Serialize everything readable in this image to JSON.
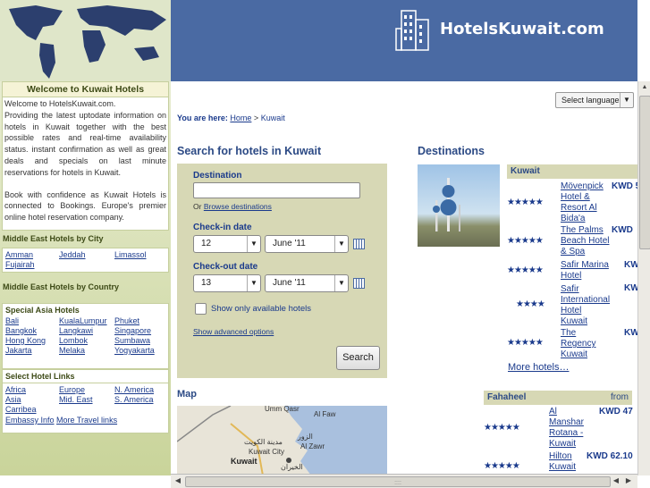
{
  "header": {
    "site_name": "HotelsKuwait.com"
  },
  "sidebar": {
    "welcome": {
      "title": "Welcome to Kuwait Hotels",
      "p1": "Welcome to HotelsKuwait.com.",
      "p2": "Providing the latest uptodate information on hotels in Kuwait together with the best possible rates and real-time availability status. instant confirmation as well as great deals and specials on last minute reservations for hotels in Kuwait.",
      "p3": "Book with confidence as Kuwait Hotels is connected to Bookings. Europe's premier online hotel reservation company."
    },
    "me_city": {
      "title": "Middle East Hotels by City",
      "links": [
        "Amman",
        "Jeddah",
        "Limassol",
        "Fujairah"
      ]
    },
    "me_country": {
      "title": "Middle East Hotels by Country"
    },
    "asia": {
      "title": "Special Asia Hotels",
      "links": [
        "Bali",
        "KualaLumpur",
        "Phuket",
        "Bangkok",
        "Langkawi",
        "Singapore",
        "Hong Kong",
        "Lombok",
        "Sumbawa",
        "Jakarta",
        "Melaka",
        "Yogyakarta"
      ]
    },
    "select": {
      "title": "Select Hotel Links",
      "links": [
        "Africa",
        "Europe",
        "N. America",
        "Asia",
        "Mid. East",
        "S. America",
        "Carribea"
      ],
      "embassy": "Embassy Info",
      "more": "More Travel links"
    }
  },
  "lang": {
    "label": "Select language",
    "arrow": "▼"
  },
  "breadcrumb": {
    "prefix": "You are here:",
    "home": "Home",
    "sep": ">",
    "current": "Kuwait"
  },
  "search": {
    "title": "Search for hotels in Kuwait",
    "destination_label": "Destination",
    "destination_value": "",
    "or": "Or",
    "browse": "Browse destinations",
    "checkin_label": "Check-in date",
    "checkin_day": "12",
    "checkin_month": "June '11",
    "checkout_label": "Check-out date",
    "checkout_day": "13",
    "checkout_month": "June '11",
    "available_only": "Show only available hotels",
    "advanced": "Show advanced options",
    "button": "Search"
  },
  "map": {
    "title": "Map",
    "labels": [
      "Umm Qasr",
      "Al Faw",
      "الزور",
      "مدينة الكويت",
      "Al Zawr",
      "Kuwait City",
      "Kuwait",
      "الخيران"
    ]
  },
  "destinations": {
    "title": "Destinations",
    "kuwait": {
      "name": "Kuwait",
      "more": "More hotels…",
      "hotels": [
        {
          "stars": "★★★★★",
          "name": "Mövenpick Hotel & Resort Al Bida'a",
          "price": "KWD 5"
        },
        {
          "stars": "★★★★★",
          "name": "The Palms Beach Hotel & Spa",
          "price": "KWD"
        },
        {
          "stars": "★★★★★",
          "name": "Safir Marina Hotel",
          "price": "KW"
        },
        {
          "stars": "★★★★",
          "name": "Safir International Hotel Kuwait",
          "price": "KW"
        },
        {
          "stars": "★★★★★",
          "name": "The Regency Kuwait",
          "price": "KW"
        }
      ]
    },
    "fahaheel": {
      "name": "Fahaheel",
      "from": "from",
      "hotels": [
        {
          "stars": "★★★★★",
          "name": "Al Manshar Rotana - Kuwait",
          "price": "KWD 47"
        },
        {
          "stars": "★★★★★",
          "name": "Hilton Kuwait",
          "price": "KWD 62.10"
        }
      ]
    }
  },
  "scroll": {
    "left": "◀",
    "right": "▶",
    "up": "▲",
    "down": "▼",
    "grip": "::::"
  }
}
